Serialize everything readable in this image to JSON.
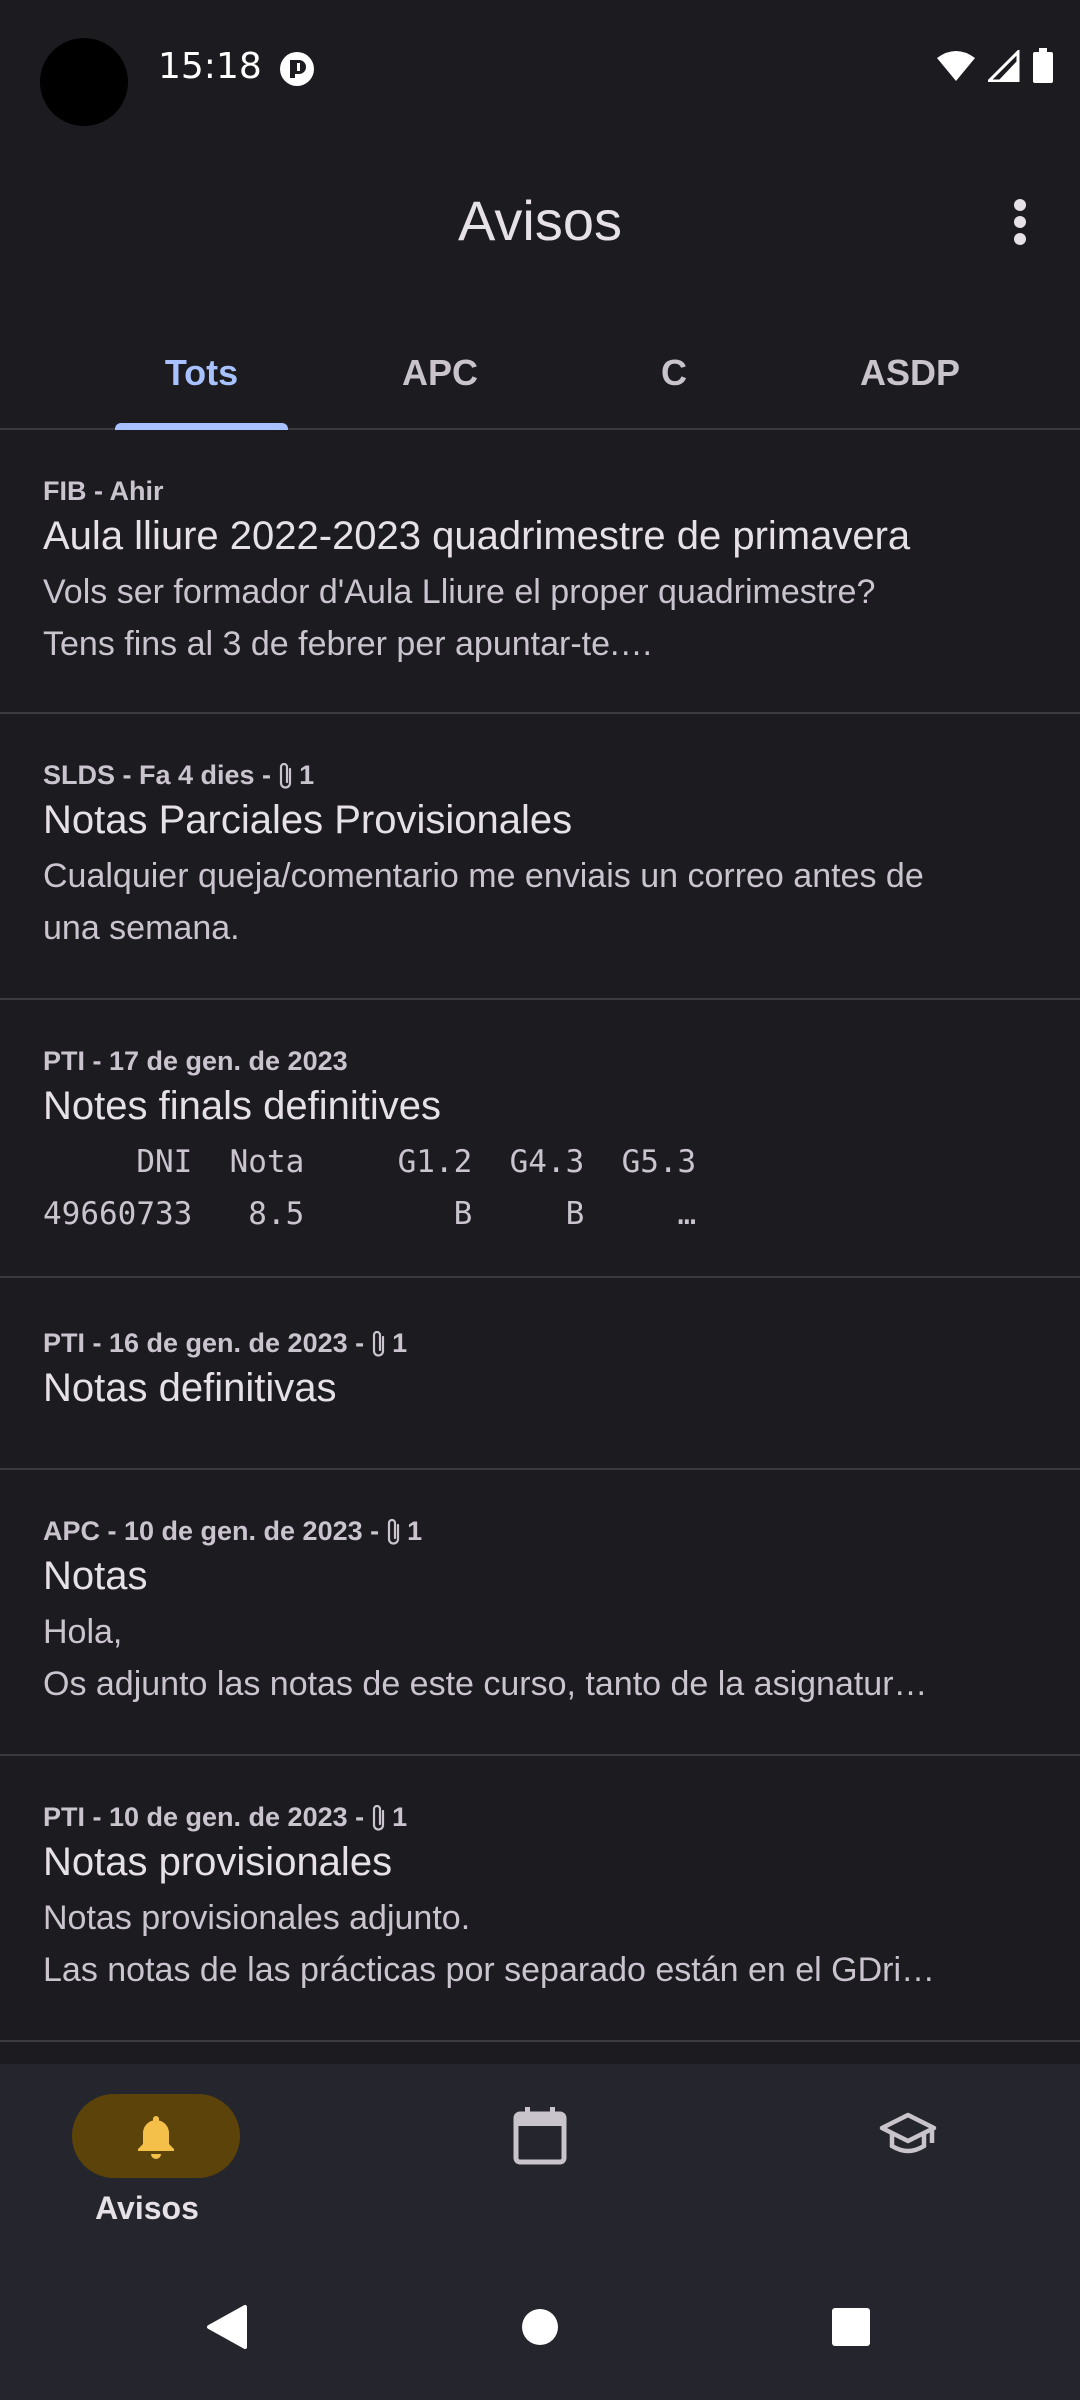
{
  "status_bar": {
    "time": "15:18",
    "icons": [
      "wifi-icon",
      "signal-icon",
      "battery-icon"
    ]
  },
  "app_bar": {
    "title": "Avisos",
    "menu_icon": "more-vert-icon"
  },
  "tabs": [
    {
      "label": "Tots",
      "active": true
    },
    {
      "label": "APC",
      "active": false
    },
    {
      "label": "C",
      "active": false
    },
    {
      "label": "ASDP",
      "active": false
    }
  ],
  "announcements": [
    {
      "meta": "FIB - Ahir",
      "attachments": "",
      "title": "Aula lliure 2022-2023 quadrimestre de primavera",
      "body_line1": "Vols ser formador d'Aula Lliure el proper quadrimestre?",
      "body_line2": "Tens fins al 3 de febrer per apuntar-te.…"
    },
    {
      "meta": "SLDS - Fa 4 dies -",
      "attachments": "1",
      "title": "Notas Parciales Provisionales",
      "body_line1": "Cualquier queja/comentario me enviais un correo antes de",
      "body_line2": "una semana."
    },
    {
      "meta": "PTI - 17 de gen. de 2023",
      "attachments": "",
      "title": "Notes finals definitives",
      "body_line1": "     DNI  Nota     G1.2  G4.3  G5.3",
      "body_line2": "49660733   8.5        B     B     …"
    },
    {
      "meta": "PTI - 16 de gen. de 2023 -",
      "attachments": "1",
      "title": "Notas definitivas",
      "body_line1": "",
      "body_line2": ""
    },
    {
      "meta": "APC - 10 de gen. de 2023 -",
      "attachments": "1",
      "title": "Notas",
      "body_line1": "Hola,",
      "body_line2": "Os adjunto las notas de este curso, tanto de la asignatur…"
    },
    {
      "meta": "PTI - 10 de gen. de 2023 -",
      "attachments": "1",
      "title": "Notas provisionales",
      "body_line1": "Notas provisionales adjunto.",
      "body_line2": "Las notas de las prácticas por separado están en el GDri…"
    }
  ],
  "bottom_nav": [
    {
      "label": "Avisos",
      "icon": "bell-icon",
      "active": true
    },
    {
      "label": "",
      "icon": "calendar-icon",
      "active": false
    },
    {
      "label": "",
      "icon": "school-icon",
      "active": false
    }
  ],
  "colors": {
    "background": "#1c1b20",
    "accent_tab": "#a8c2ff",
    "nav_pill": "#5c4309",
    "nav_active_icon": "#f5c04a"
  }
}
